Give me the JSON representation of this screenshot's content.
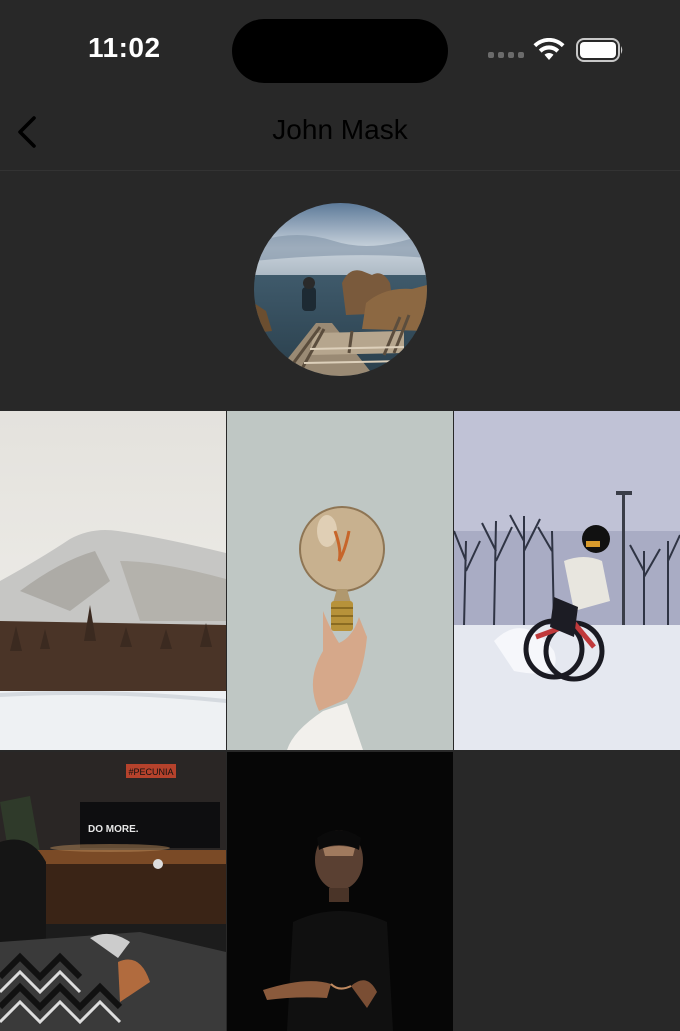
{
  "status_bar": {
    "time": "11:02",
    "icons": [
      "cellular-signal-icon",
      "wifi-icon",
      "battery-icon"
    ]
  },
  "nav": {
    "title": "John Mask",
    "back_icon": "chevron-left-icon"
  },
  "profile": {
    "avatar": "profile-photo-coast-stairs"
  },
  "photos": [
    {
      "name": "photo-snowy-mountain"
    },
    {
      "name": "photo-light-bulb-hand"
    },
    {
      "name": "photo-snow-cyclist"
    },
    {
      "name": "photo-desk-setup",
      "sign_text": "#PECUNIA",
      "screen_text": "DO MORE."
    },
    {
      "name": "photo-man-in-dark"
    }
  ],
  "colors": {
    "background": "#282828",
    "title": "#000000"
  }
}
